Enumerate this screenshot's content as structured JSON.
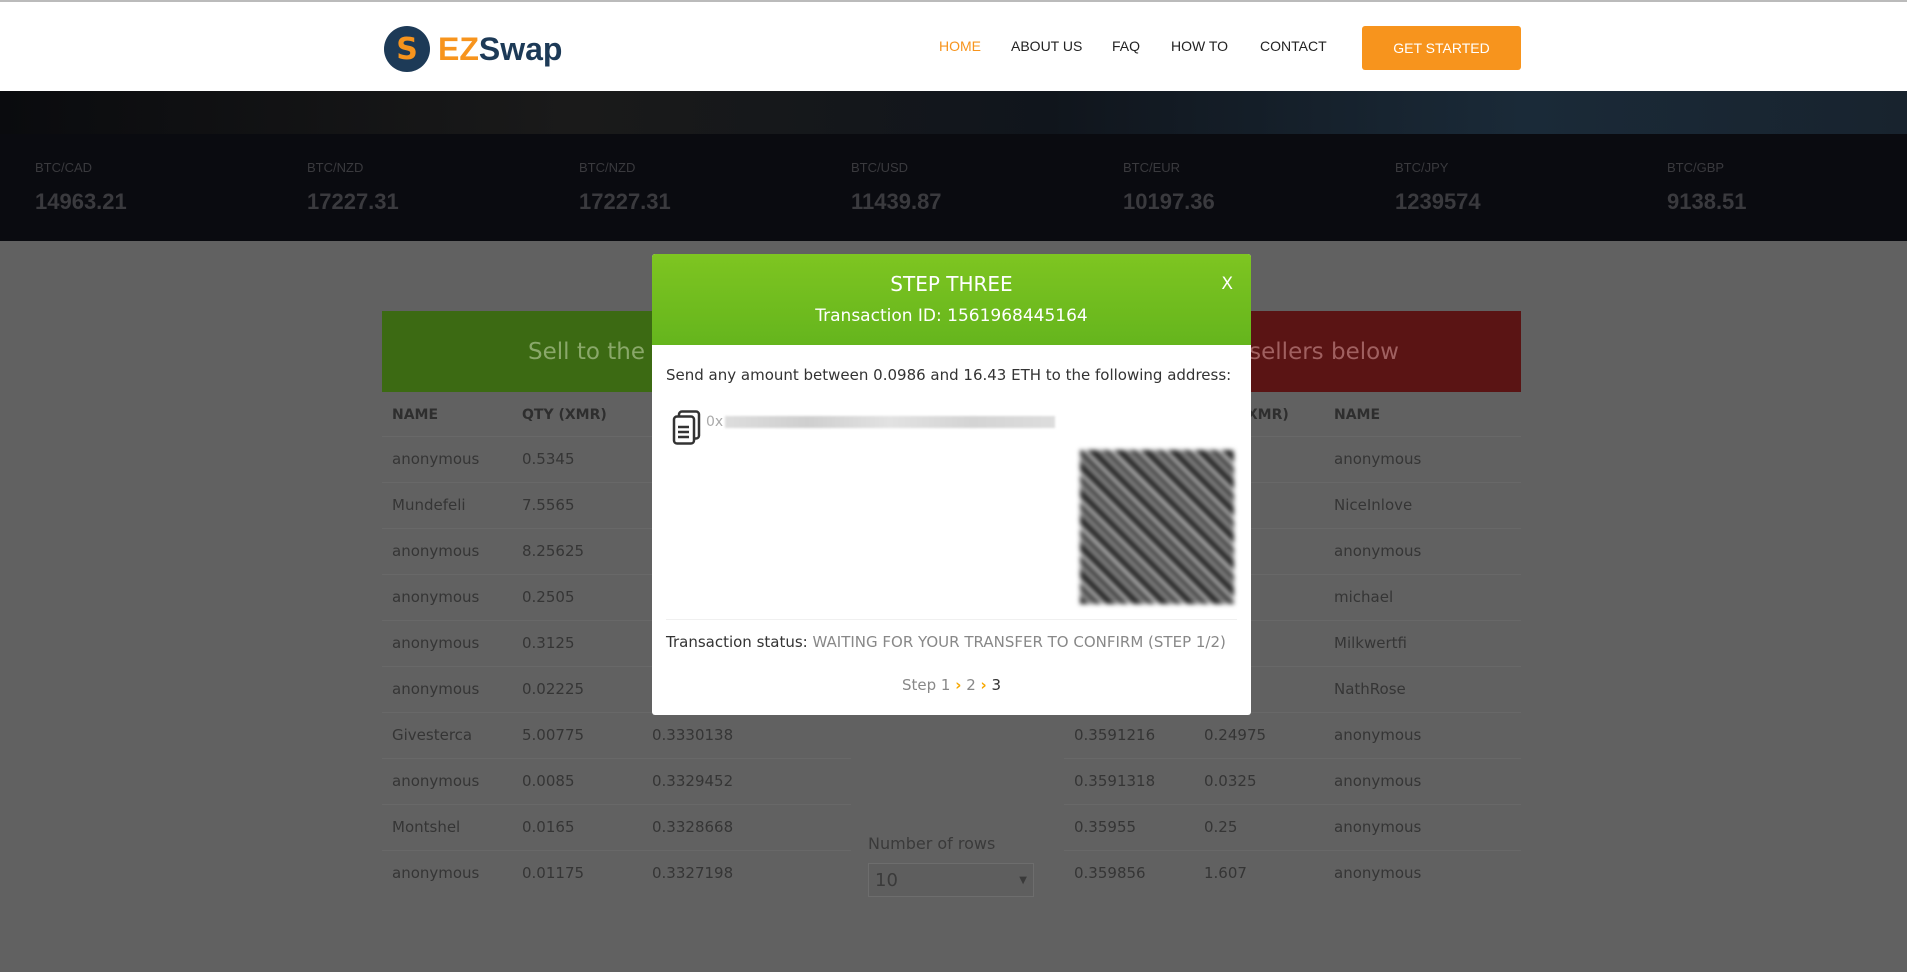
{
  "header": {
    "logo": {
      "mark": "S",
      "text_ez": "EZ",
      "text_rest": "Swap"
    },
    "nav": [
      {
        "label": "HOME",
        "active": true
      },
      {
        "label": "ABOUT US"
      },
      {
        "label": "FAQ"
      },
      {
        "label": "HOW TO"
      },
      {
        "label": "CONTACT"
      }
    ],
    "cta": "GET STARTED",
    "accent": "#f7941d"
  },
  "ticker": [
    {
      "pair": "BTC/CAD",
      "value": "14963.21"
    },
    {
      "pair": "BTC/NZD",
      "value": "17227.31"
    },
    {
      "pair": "BTC/NZD",
      "value": "17227.31"
    },
    {
      "pair": "BTC/USD",
      "value": "11439.87"
    },
    {
      "pair": "BTC/EUR",
      "value": "10197.36"
    },
    {
      "pair": "BTC/JPY",
      "value": "1239574"
    },
    {
      "pair": "BTC/GBP",
      "value": "9138.51"
    }
  ],
  "sell": {
    "title": "Sell to the buyers below",
    "headers": [
      "NAME",
      "QTY (XMR)"
    ],
    "rows": [
      [
        "anonymous",
        "0.5345",
        ""
      ],
      [
        "Mundefeli",
        "7.5565",
        ""
      ],
      [
        "anonymous",
        "8.25625",
        ""
      ],
      [
        "anonymous",
        "0.2505",
        ""
      ],
      [
        "anonymous",
        "0.3125",
        ""
      ],
      [
        "anonymous",
        "0.02225",
        ""
      ],
      [
        "Givesterca",
        "5.00775",
        "0.3330138"
      ],
      [
        "anonymous",
        "0.0085",
        "0.3329452"
      ],
      [
        "Montshel",
        "0.0165",
        "0.3328668"
      ],
      [
        "anonymous",
        "0.01175",
        "0.3327198"
      ]
    ]
  },
  "buy": {
    "title": "Buy from the sellers below",
    "headers": [
      "QTY (XMR)",
      "NAME"
    ],
    "rows": [
      [
        "",
        "",
        "anonymous"
      ],
      [
        "",
        "",
        "NiceInlove"
      ],
      [
        "",
        "",
        "anonymous"
      ],
      [
        "",
        "",
        "michael"
      ],
      [
        "",
        "",
        "Milkwertfi"
      ],
      [
        "",
        "",
        "NathRose"
      ],
      [
        "0.3591216",
        "0.24975",
        "anonymous"
      ],
      [
        "0.3591318",
        "0.0325",
        "anonymous"
      ],
      [
        "0.35955",
        "0.25",
        "anonymous"
      ],
      [
        "0.359856",
        "1.607",
        "anonymous"
      ]
    ]
  },
  "rows_control": {
    "label": "Number of rows",
    "value": "10"
  },
  "modal": {
    "title": "STEP THREE",
    "tx": "Transaction ID: 1561968445164",
    "close": "X",
    "send": "Send any amount between 0.0986 and 16.43 ETH to the following address:",
    "address_prefix": "0x",
    "icon": "copy-icon",
    "status_label": "Transaction status:",
    "status_value": "WAITING FOR YOUR TRANSFER TO CONFIRM (STEP 1/2)",
    "steps": {
      "prefix": "Step",
      "s1": "1",
      "s2": "2",
      "s3": "3"
    },
    "header_color": "#72bd1f"
  }
}
